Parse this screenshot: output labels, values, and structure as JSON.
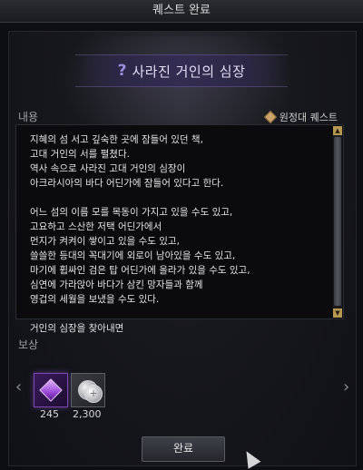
{
  "window": {
    "title": "퀘스트 완료"
  },
  "quest": {
    "title": "사라진 거인의 심장",
    "type_label": "원정대 퀘스트"
  },
  "sections": {
    "content_label": "내용",
    "reward_label": "보상"
  },
  "story_text": "지혜의 섬 서고 깊숙한 곳에 잠들어 있던 책,\n고대 거인의 서를 펼쳤다.\n역사 속으로 사라진 고대 거인의 심장이\n아크라시아의 바다 어딘가에 잠들어 있다고 한다.\n\n어느 섬의 이름 모를 목동이 가지고 있을 수도 있고,\n고요하고 스산한 저택 어딘가에서\n먼지가 켜켜이 쌓이고 있을 수도 있고,\n쓸쓸한 등대의 꼭대기에 외로이 남아있을 수도 있고,\n마기에 휩싸인 검은 탑 어딘가에 올라가 있을 수도 있고,\n심연에 가라앉아 바다가 삼킨 망자들과 함께\n영겁의 세월을 보냈을 수도 있다.\n\n거인의 심장을 찾아내면",
  "rewards": [
    {
      "icon": "purple-gem-icon",
      "count": "245"
    },
    {
      "icon": "silver-coin-icon",
      "count": "2,300"
    }
  ],
  "buttons": {
    "complete_label": "완료"
  },
  "icons": {
    "nav_prev": "‹",
    "nav_next": "›",
    "question": "?",
    "scroll_up": "▲",
    "scroll_down": "▼"
  },
  "colors": {
    "accent_purple": "#9a8fe0",
    "quest_type_gold": "#caa46a",
    "scroll_gold": "#b79a52"
  }
}
